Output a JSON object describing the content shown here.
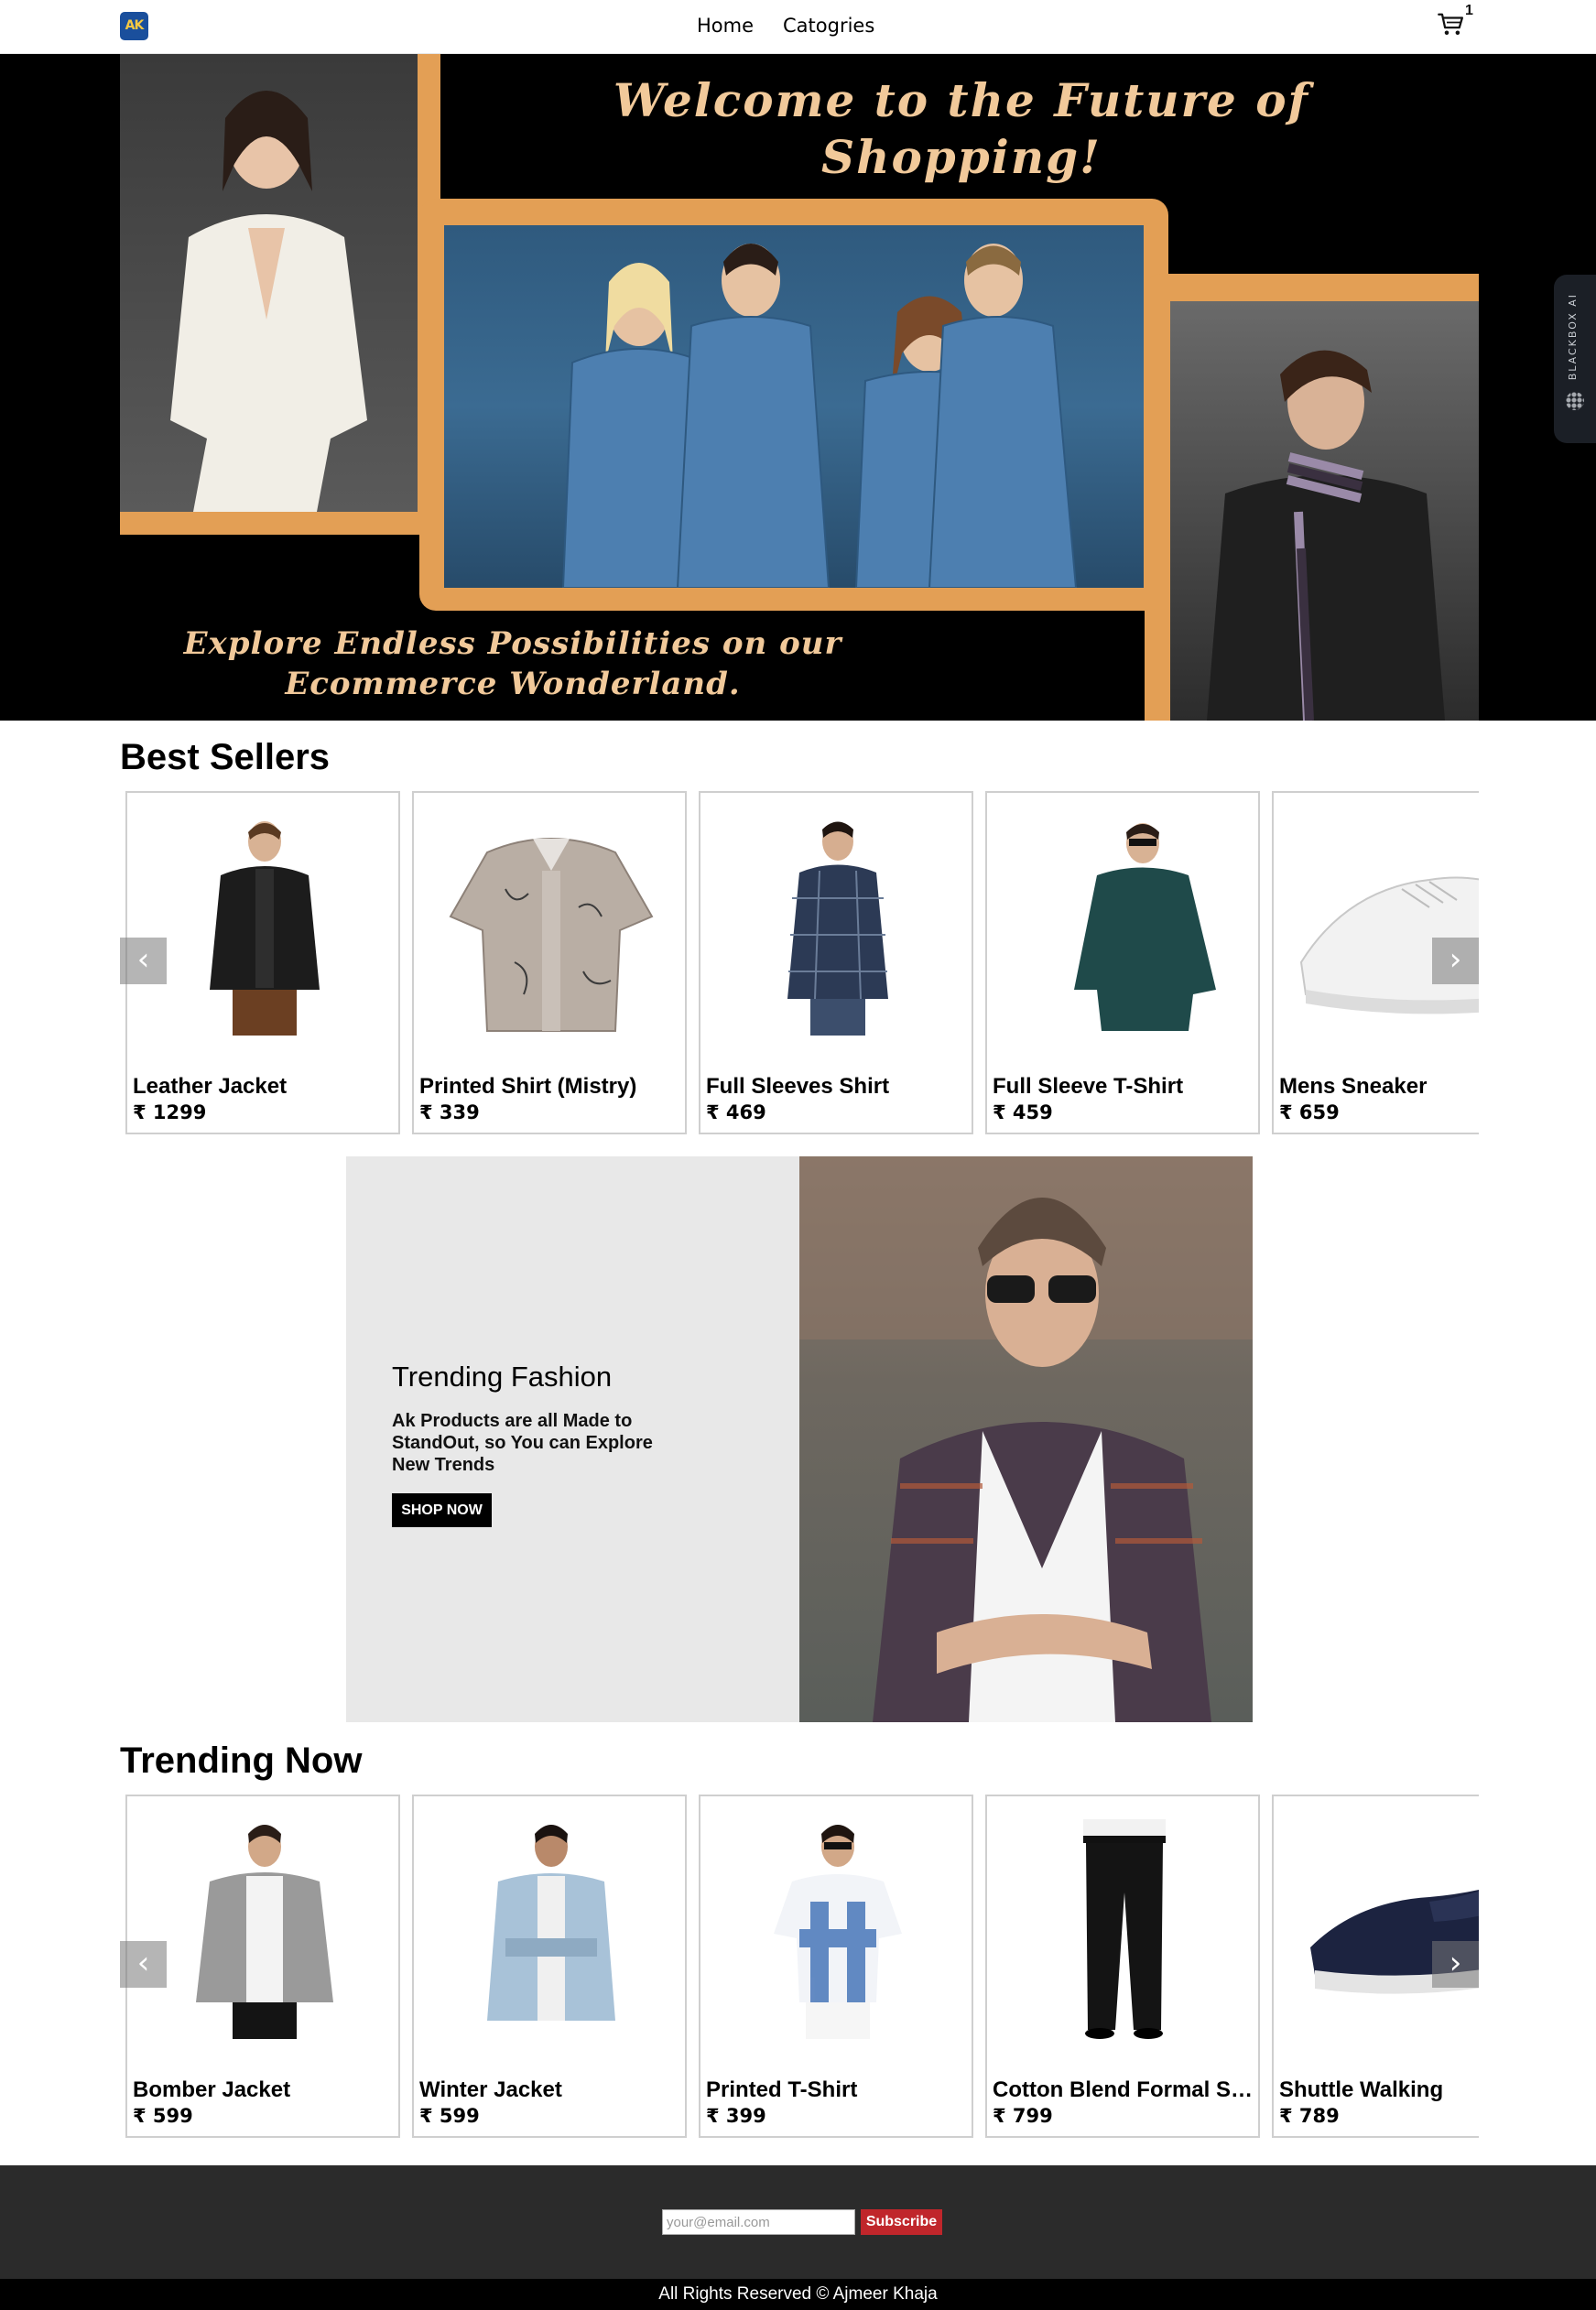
{
  "navbar": {
    "logo_text": "AK",
    "links": [
      "Home",
      "Catogries"
    ],
    "cart_icon": "cart-icon",
    "cart_count": "1"
  },
  "hero": {
    "title": "Welcome to the Future of Shopping!",
    "subtitle": "Explore Endless Possibilities on our Ecommerce Wonderland.",
    "frame_color": "#e39f55",
    "text_color": "#f1c99a"
  },
  "best_sellers": {
    "title": "Best Sellers",
    "prev_icon": "chevron-left-icon",
    "next_icon": "chevron-right-icon",
    "items": [
      {
        "name": "Leather Jacket",
        "price": "₹ 1299"
      },
      {
        "name": "Printed Shirt (Mistry)",
        "price": "₹ 339"
      },
      {
        "name": "Full Sleeves Shirt",
        "price": "₹ 469"
      },
      {
        "name": "Full Sleeve T-Shirt",
        "price": "₹ 459"
      },
      {
        "name": "Mens Sneaker",
        "price": "₹ 659"
      }
    ]
  },
  "promo": {
    "title": "Trending Fashion",
    "text": "Ak Products are all Made to StandOut, so You can Explore New Trends",
    "button": "SHOP NOW"
  },
  "trending_now": {
    "title": "Trending Now",
    "items": [
      {
        "name": "Bomber Jacket",
        "price": "₹ 599"
      },
      {
        "name": "Winter Jacket",
        "price": "₹ 599"
      },
      {
        "name": "Printed T-Shirt",
        "price": "₹ 399"
      },
      {
        "name": "Cotton Blend Formal Shirt",
        "price": "₹ 799"
      },
      {
        "name": "Shuttle Walking",
        "price": "₹ 789"
      }
    ]
  },
  "footer": {
    "email_placeholder": "your@email.com",
    "subscribe": "Subscribe",
    "copyright": "All Rights Reserved © Ajmeer Khaja",
    "accent_color": "#c0262b"
  },
  "side_tab": {
    "label": "BLACKBOX AI"
  }
}
